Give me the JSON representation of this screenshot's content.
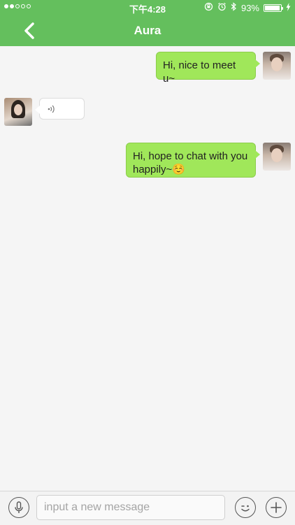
{
  "status_bar": {
    "time": "下午4:28",
    "battery_percent": "93%",
    "battery_level": 0.93,
    "signal_dots": [
      true,
      true,
      false,
      false,
      false
    ],
    "icons": [
      "orientation-lock-icon",
      "alarm-icon",
      "bluetooth-icon",
      "battery-icon",
      "charging-bolt-icon"
    ]
  },
  "nav": {
    "title": "Aura",
    "back_icon": "chevron-left-icon"
  },
  "messages": [
    {
      "direction": "outgoing",
      "type": "text",
      "text": "Hi, nice to meet u~",
      "avatar": "me"
    },
    {
      "direction": "incoming",
      "type": "voice",
      "icon": "voice-wave-icon",
      "avatar": "Aura"
    },
    {
      "direction": "outgoing",
      "type": "text",
      "text": "Hi, hope to chat with you happily~☺️",
      "avatar": "me"
    }
  ],
  "input_bar": {
    "placeholder": "input a new message",
    "left_icon": "microphone-icon",
    "emoji_icon": "wink-emoji-icon",
    "plus_icon": "plus-icon"
  },
  "colors": {
    "header": "#64bf5d",
    "outgoing_bubble": "#a0e75a",
    "background": "#f5f5f5"
  }
}
